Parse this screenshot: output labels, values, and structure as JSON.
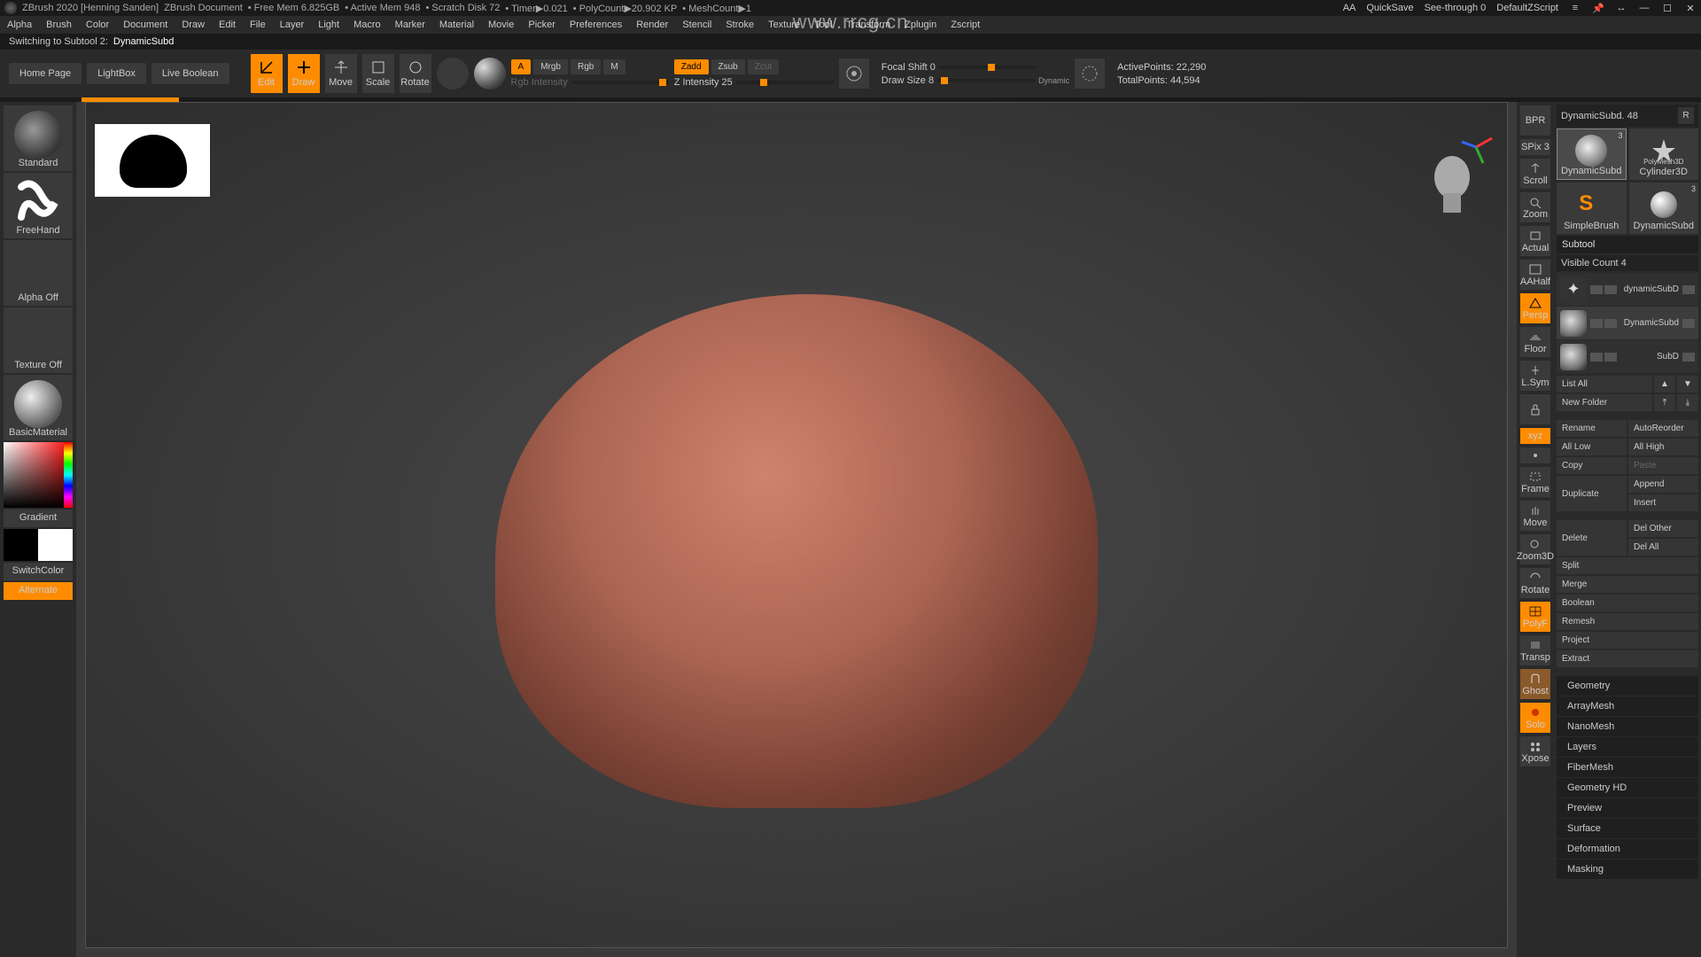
{
  "titlebar": {
    "app": "ZBrush 2020 [Henning Sanden]",
    "doc": "ZBrush Document",
    "freemem": "• Free Mem 6.825GB",
    "activemem": "• Active Mem 948",
    "scratch": "• Scratch Disk 72",
    "timer": "• Timer▶0.021",
    "polycount": "• PolyCount▶20.902 KP",
    "meshcount": "• MeshCount▶1",
    "aa": "AA",
    "quicksave": "QuickSave",
    "seethrough": "See-through 0",
    "script": "DefaultZScript"
  },
  "watermark": "www.rrcg.cn",
  "menubar": [
    "Alpha",
    "Brush",
    "Color",
    "Document",
    "Draw",
    "Edit",
    "File",
    "Layer",
    "Light",
    "Macro",
    "Marker",
    "Material",
    "Movie",
    "Picker",
    "Preferences",
    "Render",
    "Stencil",
    "Stroke",
    "Texture",
    "Tool",
    "Transform",
    "Zplugin",
    "Zscript"
  ],
  "status": {
    "label": "Switching to Subtool 2:",
    "value": "DynamicSubd"
  },
  "toptool": {
    "home": "Home Page",
    "lightbox": "LightBox",
    "liveboolean": "Live Boolean",
    "edit": "Edit",
    "draw": "Draw",
    "move": "Move",
    "scale": "Scale",
    "rotate": "Rotate",
    "a": "A",
    "mrgb": "Mrgb",
    "rgb": "Rgb",
    "m": "M",
    "rgbi": "Rgb Intensity",
    "zadd": "Zadd",
    "zsub": "Zsub",
    "zcut": "Zcut",
    "zint": "Z Intensity 25",
    "focal": "Focal Shift 0",
    "drawsize": "Draw Size 8",
    "dynamic": "Dynamic",
    "activepts": "ActivePoints: 22,290",
    "totalpts": "TotalPoints: 44,594"
  },
  "left": {
    "brush": "Standard",
    "stroke": "FreeHand",
    "alpha": "Alpha Off",
    "texture": "Texture Off",
    "material": "BasicMaterial",
    "gradient": "Gradient",
    "switch": "SwitchColor",
    "alternate": "Alternate"
  },
  "shelf": {
    "bpr": "BPR",
    "spix": "SPix 3",
    "scroll": "Scroll",
    "zoom": "Zoom",
    "actual": "Actual",
    "aahalf": "AAHalf",
    "persp": "Persp",
    "floor": "Floor",
    "lsym": "L.Sym",
    "lock": "",
    "xyz": "xyz",
    "center": "",
    "frame": "Frame",
    "move": "Move",
    "zoom3d": "Zoom3D",
    "rotate": "Rotate",
    "polyf": "PolyF",
    "transp": "Transp",
    "ghost": "Ghost",
    "solo": "Solo",
    "xpose": "Xpose"
  },
  "tool": {
    "header": "DynamicSubd. 48",
    "r": "R",
    "cells": [
      {
        "label": "DynamicSubd",
        "badge": "3"
      },
      {
        "label": "Cylinder3D",
        "badge": ""
      },
      {
        "label": "SimpleBrush",
        "badge": ""
      },
      {
        "label": "DynamicSubd",
        "badge": "3"
      }
    ],
    "polymesh": "PolyMesh3D"
  },
  "subtool": {
    "header": "Subtool",
    "visible": "Visible Count 4",
    "items": [
      {
        "name": "dynamicSubD"
      },
      {
        "name": "DynamicSubd"
      },
      {
        "name": "SubD"
      }
    ],
    "listall": "List All",
    "newfolder": "New Folder",
    "rename": "Rename",
    "autoreorder": "AutoReorder",
    "alllow": "All Low",
    "allhigh": "All High",
    "copy": "Copy",
    "paste": "Paste",
    "duplicate": "Duplicate",
    "append": "Append",
    "insert": "Insert",
    "delete": "Delete",
    "delother": "Del Other",
    "delall": "Del All",
    "split": "Split",
    "merge": "Merge",
    "boolean": "Boolean",
    "remesh": "Remesh",
    "project": "Project",
    "extract": "Extract"
  },
  "sections": [
    "Geometry",
    "ArrayMesh",
    "NanoMesh",
    "Layers",
    "FiberMesh",
    "Geometry HD",
    "Preview",
    "Surface",
    "Deformation",
    "Masking"
  ]
}
